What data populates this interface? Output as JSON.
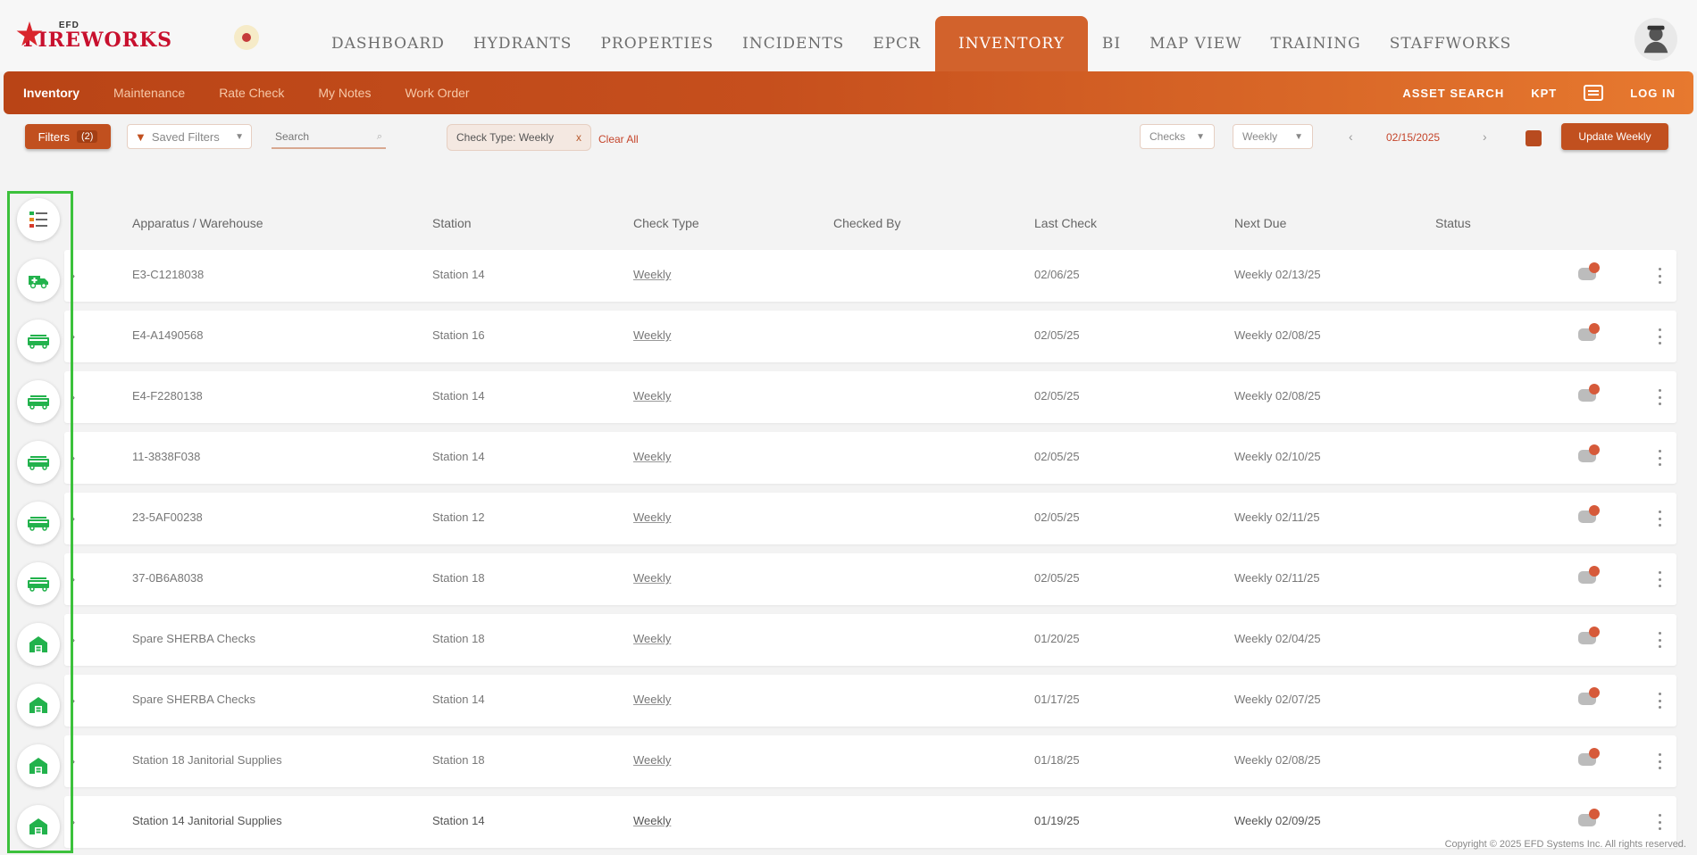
{
  "app": {
    "logo_small": "EFD",
    "logo_big": "FIREWORKS",
    "nav": [
      "DASHBOARD",
      "HYDRANTS",
      "PROPERTIES",
      "INCIDENTS",
      "EPCR",
      "INVENTORY",
      "BI",
      "MAP VIEW",
      "TRAINING",
      "STAFFWORKS"
    ],
    "nav_active": "INVENTORY"
  },
  "subnav": {
    "items": [
      "Inventory",
      "Maintenance",
      "Rate Check",
      "My Notes",
      "Work Order"
    ],
    "active": "Inventory",
    "right_label": "ASSET SEARCH",
    "right_label2": "KPT",
    "right_label3": "LOG IN"
  },
  "filters": {
    "filters_label": "Filters",
    "filters_count": "(2)",
    "saved_filters": "Saved Filters",
    "search_placeholder": "Search",
    "chip_label": "Check Type: Weekly",
    "chip_close": "x",
    "clear_all": "Clear All",
    "select1": "Checks",
    "select2": "Weekly",
    "date": "02/15/2025",
    "prev": "‹",
    "next": "›",
    "update_button": "Update Weekly"
  },
  "table": {
    "columns": [
      "Apparatus / Warehouse",
      "Station",
      "Check Type",
      "Checked By",
      "Last Check",
      "Next Due",
      "Status"
    ],
    "rows": [
      {
        "apparatus": "E3-C1218038",
        "station": "Station 14",
        "check_type": "Weekly",
        "checked_by": "",
        "last_check": "02/06/25",
        "next_due": "Weekly 02/13/25"
      },
      {
        "apparatus": "E4-A1490568",
        "station": "Station 16",
        "check_type": "Weekly",
        "checked_by": "",
        "last_check": "02/05/25",
        "next_due": "Weekly 02/08/25"
      },
      {
        "apparatus": "E4-F2280138",
        "station": "Station 14",
        "check_type": "Weekly",
        "checked_by": "",
        "last_check": "02/05/25",
        "next_due": "Weekly 02/08/25"
      },
      {
        "apparatus": "11-3838F038",
        "station": "Station 14",
        "check_type": "Weekly",
        "checked_by": "",
        "last_check": "02/05/25",
        "next_due": "Weekly 02/10/25"
      },
      {
        "apparatus": "23-5AF00238",
        "station": "Station 12",
        "check_type": "Weekly",
        "checked_by": "",
        "last_check": "02/05/25",
        "next_due": "Weekly 02/11/25"
      },
      {
        "apparatus": "37-0B6A8038",
        "station": "Station 18",
        "check_type": "Weekly",
        "checked_by": "",
        "last_check": "02/05/25",
        "next_due": "Weekly 02/11/25"
      },
      {
        "apparatus": "Spare SHERBA Checks",
        "station": "Station 18",
        "check_type": "Weekly",
        "checked_by": "",
        "last_check": "01/20/25",
        "next_due": "Weekly 02/04/25"
      },
      {
        "apparatus": "Spare SHERBA Checks",
        "station": "Station 14",
        "check_type": "Weekly",
        "checked_by": "",
        "last_check": "01/17/25",
        "next_due": "Weekly 02/07/25"
      },
      {
        "apparatus": "Station 18 Janitorial Supplies",
        "station": "Station 18",
        "check_type": "Weekly",
        "checked_by": "",
        "last_check": "01/18/25",
        "next_due": "Weekly 02/08/25"
      },
      {
        "apparatus": "Station 14 Janitorial Supplies",
        "station": "Station 14",
        "check_type": "Weekly",
        "checked_by": "",
        "last_check": "01/19/25",
        "next_due": "Weekly 02/09/25"
      }
    ]
  },
  "rail": {
    "icons": [
      "list-icon",
      "ambulance-icon",
      "fire-truck-icon",
      "fire-truck-icon",
      "fire-truck-icon",
      "fire-truck-icon",
      "fire-truck-icon",
      "warehouse-icon",
      "warehouse-icon",
      "warehouse-icon",
      "warehouse-icon"
    ]
  },
  "footer": "Copyright © 2025 EFD Systems Inc. All rights reserved.",
  "colors": {
    "accent": "#c1501f",
    "active_tab": "#d2622c",
    "rail_highlight": "#3cc13c",
    "icon_green": "#22b24c"
  }
}
